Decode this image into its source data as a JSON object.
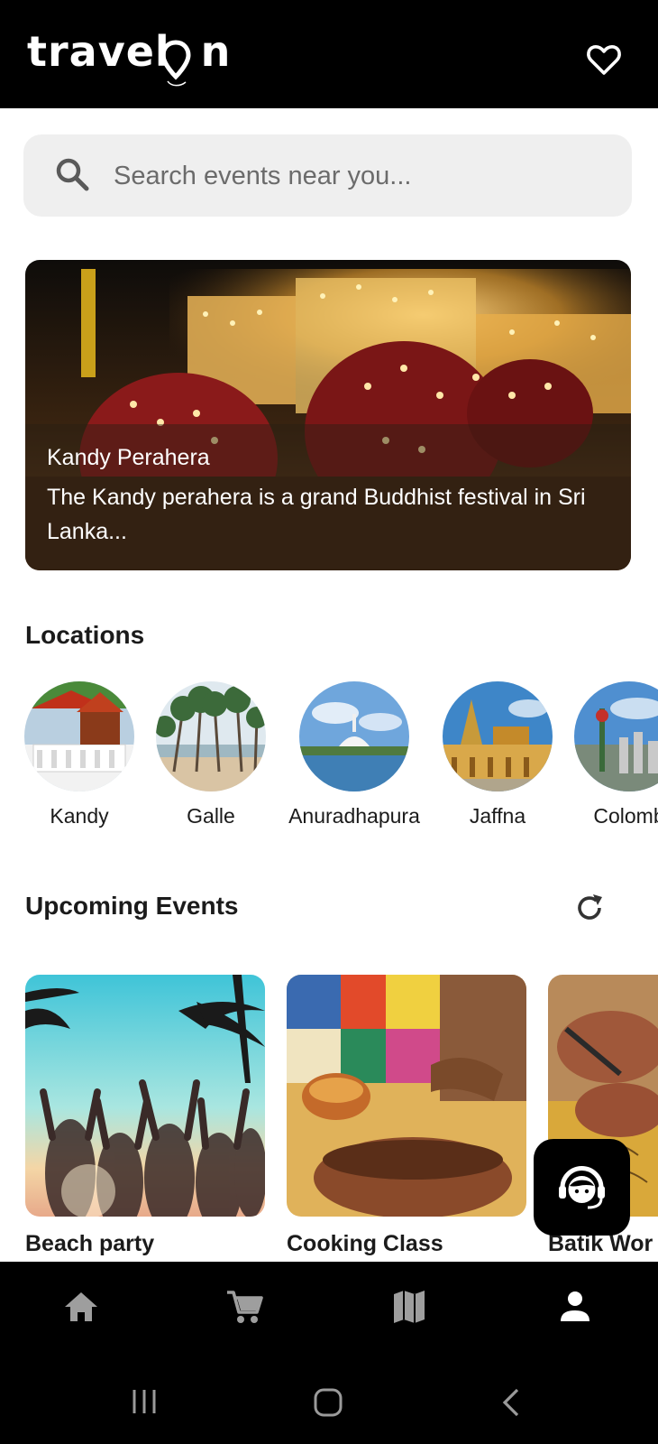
{
  "app": {
    "logo_text": "travel",
    "logo_tail": "n"
  },
  "header": {
    "favorite_icon": "heart-outline-icon"
  },
  "search": {
    "placeholder": "Search events near you...",
    "icon": "search-icon"
  },
  "hero": {
    "title": "Kandy Perahera",
    "description": "The Kandy perahera is a grand Buddhist festival in Sri Lanka..."
  },
  "sections": {
    "locations": "Locations",
    "upcoming": "Upcoming Events"
  },
  "locations": [
    {
      "name": "Kandy"
    },
    {
      "name": "Galle"
    },
    {
      "name": "Anuradhapura"
    },
    {
      "name": "Jaffna"
    },
    {
      "name": "Colomb"
    }
  ],
  "events": [
    {
      "name": "Beach party"
    },
    {
      "name": "Cooking Class"
    },
    {
      "name": "Batik Wor"
    }
  ],
  "fab": {
    "icon": "support-agent-icon"
  },
  "bottom_nav": [
    {
      "icon": "home-icon"
    },
    {
      "icon": "cart-icon"
    },
    {
      "icon": "map-icon"
    },
    {
      "icon": "person-icon",
      "active": true
    }
  ],
  "system_nav": [
    "recents-icon",
    "home-circle-icon",
    "back-icon"
  ]
}
